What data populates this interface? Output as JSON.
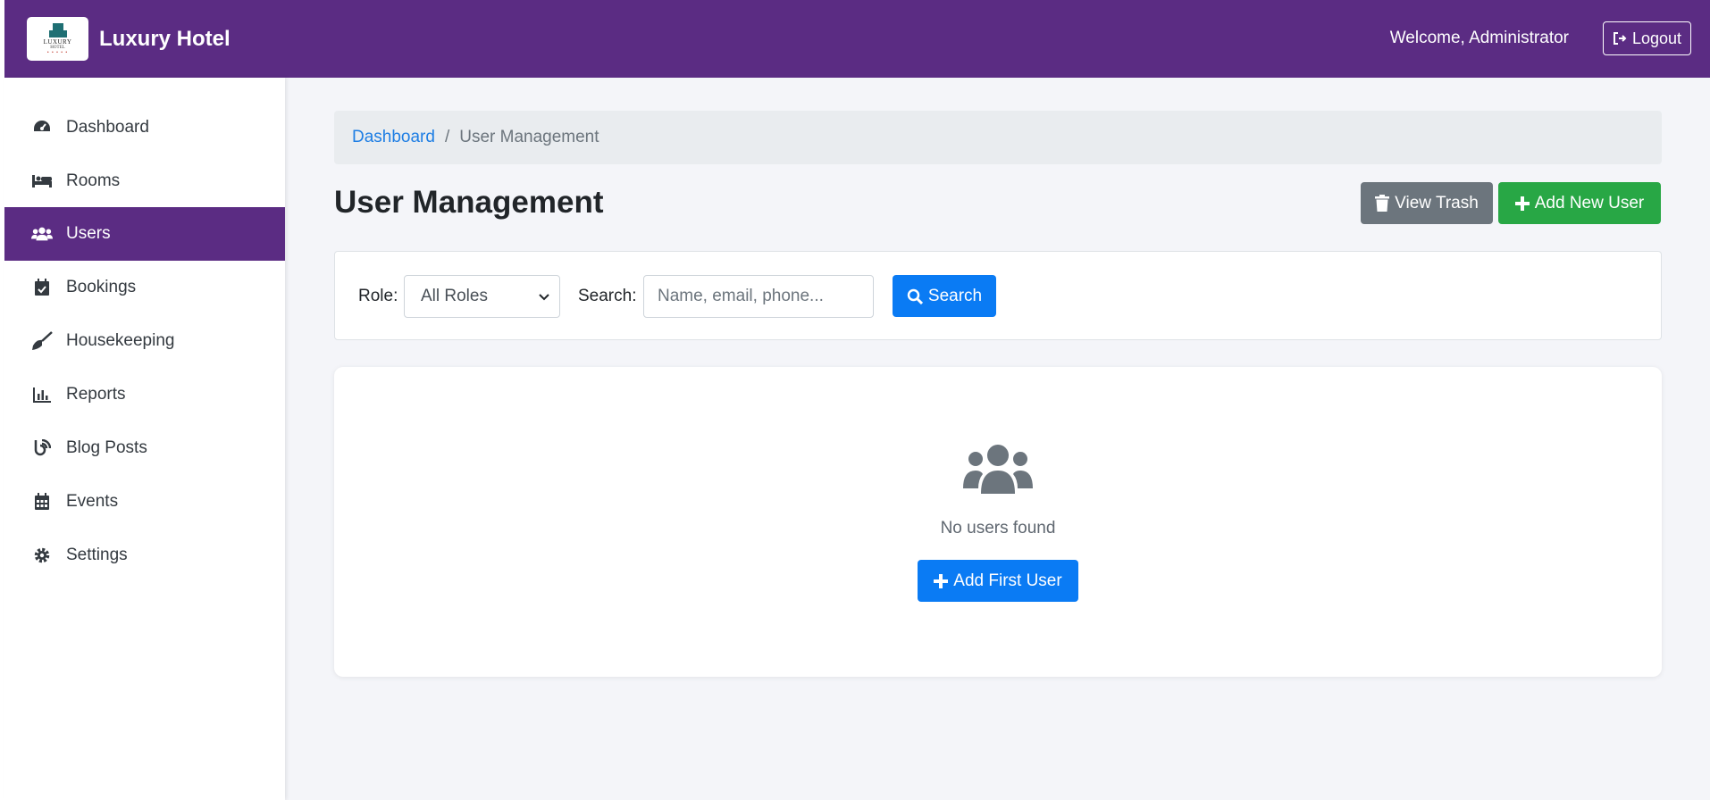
{
  "header": {
    "logo": {
      "name": "LUXURY",
      "sub": "HOTEL",
      "dots": "• • • • •"
    },
    "brand_title": "Luxury Hotel",
    "welcome": "Welcome, Administrator",
    "logout_label": "Logout"
  },
  "sidebar": {
    "items": [
      {
        "label": "Dashboard",
        "icon": "tachometer-icon"
      },
      {
        "label": "Rooms",
        "icon": "bed-icon"
      },
      {
        "label": "Users",
        "icon": "users-icon",
        "active": true
      },
      {
        "label": "Bookings",
        "icon": "calendar-check-icon"
      },
      {
        "label": "Housekeeping",
        "icon": "broom-icon"
      },
      {
        "label": "Reports",
        "icon": "chart-bar-icon"
      },
      {
        "label": "Blog Posts",
        "icon": "blog-icon"
      },
      {
        "label": "Events",
        "icon": "calendar-icon"
      },
      {
        "label": "Settings",
        "icon": "gear-icon"
      }
    ]
  },
  "breadcrumb": {
    "home": "Dashboard",
    "separator": "/",
    "current": "User Management"
  },
  "page": {
    "title": "User Management",
    "view_trash_label": "View Trash",
    "add_new_user_label": "Add New User"
  },
  "filters": {
    "role_label": "Role:",
    "role_value": "All Roles",
    "search_label": "Search:",
    "search_placeholder": "Name, email, phone...",
    "search_value": "",
    "search_button": "Search"
  },
  "empty_state": {
    "message": "No users found",
    "add_first_label": "Add First User"
  },
  "colors": {
    "brand": "#5b2c83",
    "primary": "#0a7bf4",
    "success": "#28a745",
    "secondary": "#6c757d"
  }
}
